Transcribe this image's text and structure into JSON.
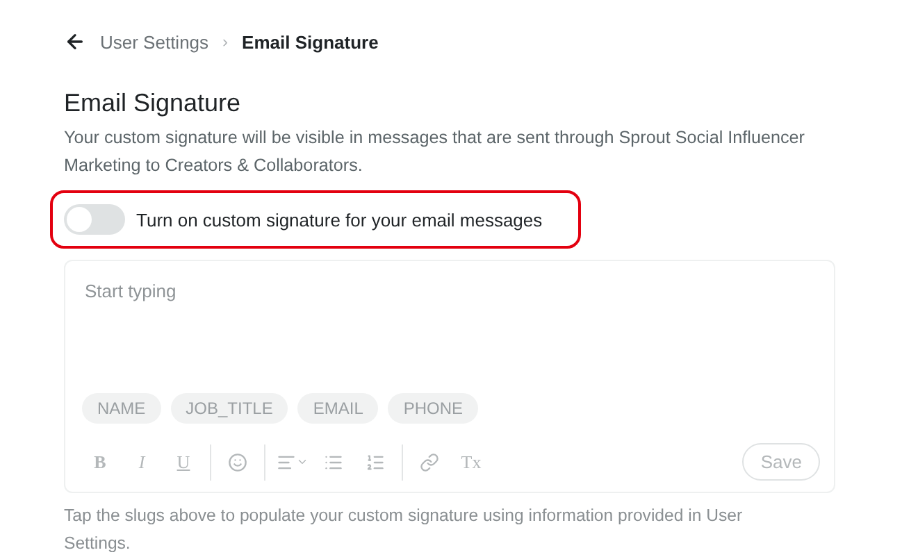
{
  "breadcrumb": {
    "items": [
      {
        "label": "User Settings",
        "current": false
      },
      {
        "label": "Email Signature",
        "current": true
      }
    ],
    "separator": "›"
  },
  "heading": "Email Signature",
  "description": "Your custom signature will be visible in messages that are sent through Sprout Social Influencer Marketing to Creators & Collaborators.",
  "toggle": {
    "label": "Turn on custom signature for your email messages",
    "on": false,
    "highlighted": true
  },
  "editor": {
    "placeholder": "Start typing",
    "disabled": true,
    "slugs": [
      "NAME",
      "JOB_TITLE",
      "EMAIL",
      "PHONE"
    ],
    "toolbar": [
      {
        "kind": "bold",
        "label": "B"
      },
      {
        "kind": "italic",
        "label": "I"
      },
      {
        "kind": "underline",
        "label": "U"
      },
      {
        "kind": "divider"
      },
      {
        "kind": "emoji"
      },
      {
        "kind": "divider"
      },
      {
        "kind": "align"
      },
      {
        "kind": "bullets"
      },
      {
        "kind": "numbers"
      },
      {
        "kind": "divider"
      },
      {
        "kind": "link"
      },
      {
        "kind": "clear",
        "label": "Tx"
      }
    ],
    "save": "Save"
  },
  "helper": "Tap the slugs above to populate your custom signature using information provided in User Settings."
}
